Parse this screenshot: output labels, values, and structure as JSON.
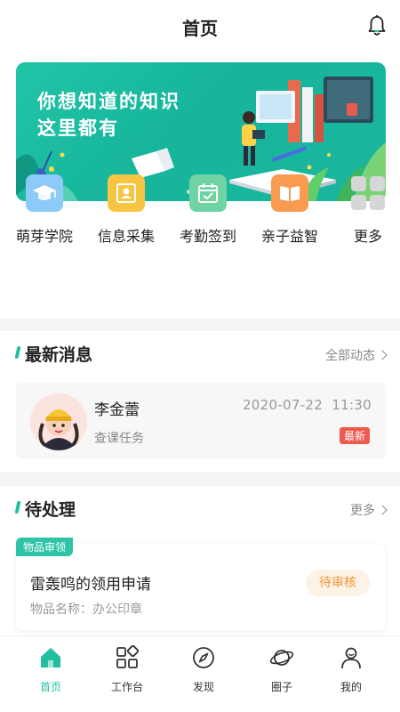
{
  "header": {
    "title": "首页",
    "bell_icon": "bell-icon"
  },
  "banner": {
    "line1": "你想知道的知识",
    "line2": "这里都有",
    "dot_count": 3,
    "active_dot": 1
  },
  "menu": [
    {
      "label": "萌芽学院",
      "icon": "graduation-cap-icon",
      "color": "#7ec4f5"
    },
    {
      "label": "信息采集",
      "icon": "id-card-icon",
      "color": "#f8c543"
    },
    {
      "label": "考勤签到",
      "icon": "calendar-check-icon",
      "color": "#6fd3a3"
    },
    {
      "label": "亲子益智",
      "icon": "book-icon",
      "color": "#f89a4f"
    },
    {
      "label": "更多",
      "icon": "grid-icon",
      "color": "#d0d0d0"
    }
  ],
  "news": {
    "title": "最新消息",
    "more_label": "全部动态",
    "item": {
      "name": "李金蕾",
      "subtitle": "查课任务",
      "date": "2020-07-22",
      "time": "11:30",
      "badge": "最新"
    }
  },
  "todo": {
    "title": "待处理",
    "more_label": "更多",
    "item": {
      "tag": "物品审领",
      "title": "雷轰鸣的领用申请",
      "subtitle": "物品名称：办公印章",
      "status": "待审核"
    }
  },
  "tabs": [
    {
      "label": "首页",
      "icon": "home-icon",
      "active": true
    },
    {
      "label": "工作台",
      "icon": "workbench-icon",
      "active": false
    },
    {
      "label": "发现",
      "icon": "compass-icon",
      "active": false
    },
    {
      "label": "圈子",
      "icon": "planet-icon",
      "active": false
    },
    {
      "label": "我的",
      "icon": "user-icon",
      "active": false
    }
  ],
  "colors": {
    "accent": "#1fbf9f",
    "badge": "#ee5a4f",
    "status": "#f0973a"
  }
}
